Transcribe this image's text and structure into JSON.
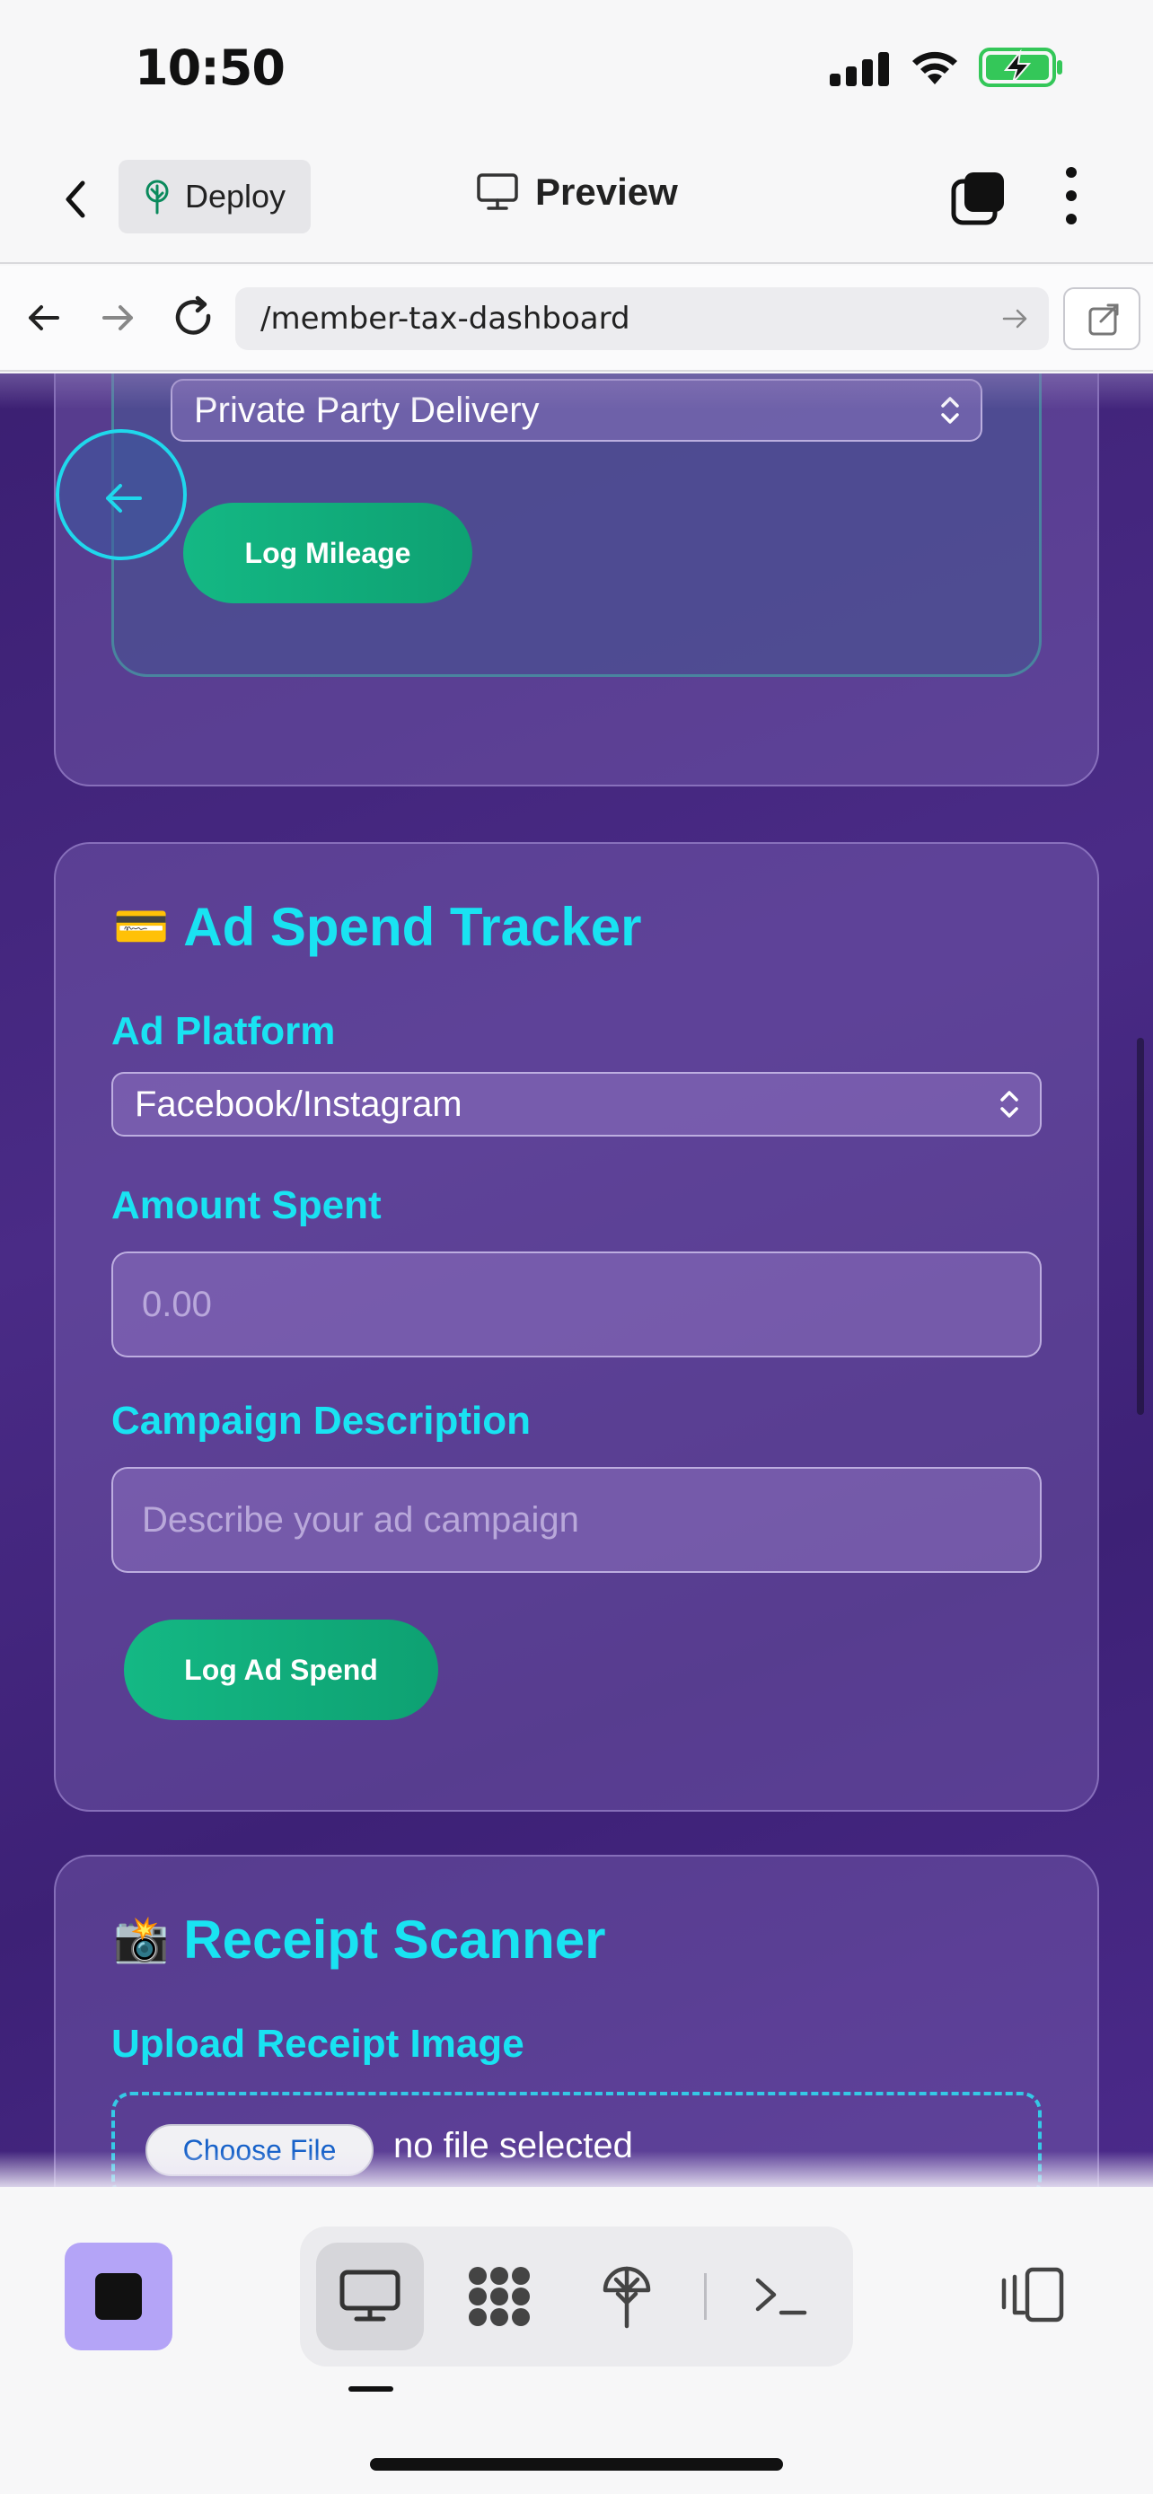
{
  "status": {
    "time": "10:50",
    "battery_color": "#34c759"
  },
  "header": {
    "deploy_label": "Deploy",
    "preview_label": "Preview"
  },
  "browser": {
    "url": "/member-tax-dashboard"
  },
  "mileage_card": {
    "purpose_select_value": "Private Party Delivery",
    "log_button": "Log Mileage"
  },
  "ad_spend_card": {
    "icon": "credit-card-emoji",
    "icon_glyph": "💳",
    "title": "Ad Spend Tracker",
    "platform_label": "Ad Platform",
    "platform_value": "Facebook/Instagram",
    "amount_label": "Amount Spent",
    "amount_placeholder": "0.00",
    "description_label": "Campaign Description",
    "description_placeholder": "Describe your ad campaign",
    "log_button": "Log Ad Spend"
  },
  "receipt_card": {
    "icon": "camera-flash-emoji",
    "icon_glyph": "📸",
    "title": "Receipt Scanner",
    "upload_label": "Upload Receipt Image",
    "choose_file": "Choose File",
    "no_file": "no file selected"
  },
  "theme": {
    "accent_cyan": "#19e3f2",
    "button_green": "#14b884",
    "bg_purple": "#3b1f72"
  }
}
